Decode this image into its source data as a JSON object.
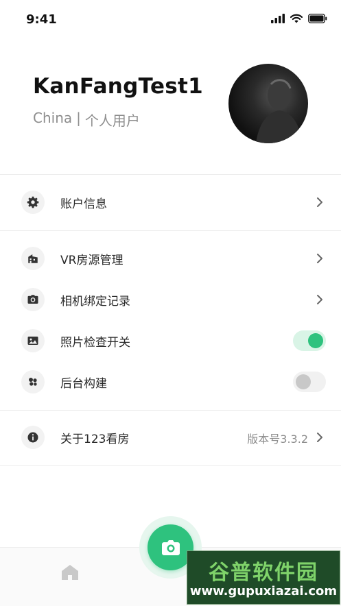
{
  "status_bar": {
    "time": "9:41"
  },
  "profile": {
    "username": "KanFangTest1",
    "region": "China",
    "separator": "|",
    "user_type": "个人用户"
  },
  "menu": {
    "account_info": {
      "label": "账户信息",
      "icon": "gear-icon"
    },
    "vr_listings": {
      "label": "VR房源管理",
      "icon": "building-icon"
    },
    "camera_binding": {
      "label": "相机绑定记录",
      "icon": "camera-icon"
    },
    "photo_check": {
      "label": "照片检查开关",
      "icon": "image-icon",
      "enabled": true
    },
    "background_build": {
      "label": "后台构建",
      "icon": "cluster-icon",
      "enabled": false
    },
    "about": {
      "label": "关于123看房",
      "icon": "info-icon",
      "version": "版本号3.3.2"
    }
  },
  "tabbar": {
    "home_icon": "home-icon",
    "capture_icon": "camera-icon"
  },
  "watermark": {
    "title": "谷普软件园",
    "url": "www.gupuxiazai.com"
  },
  "colors": {
    "accent": "#2ec27e",
    "accent_light": "#d9f4e6",
    "text_secondary": "#8e8e8e"
  }
}
